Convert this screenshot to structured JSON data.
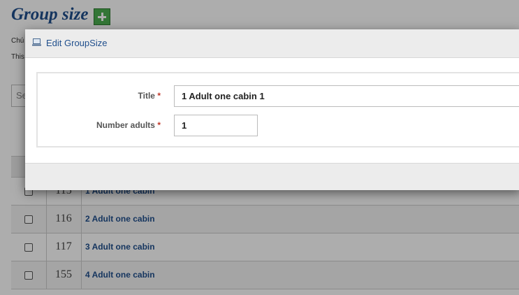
{
  "page": {
    "title": "Group size",
    "intro_line_1": "Chú",
    "intro_line_2": "This",
    "search_placeholder": "Se"
  },
  "table": {
    "rows": [
      {
        "id": "115",
        "title": "1 Adult one cabin"
      },
      {
        "id": "116",
        "title": "2 Adult one cabin"
      },
      {
        "id": "117",
        "title": "3 Adult one cabin"
      },
      {
        "id": "155",
        "title": "4 Adult one cabin"
      }
    ]
  },
  "modal": {
    "title": "Edit GroupSize",
    "fields": {
      "title_label": "Title",
      "title_value": "1 Adult one cabin 1",
      "adults_label": "Number adults",
      "adults_value": "1",
      "required_mark": "*"
    }
  },
  "colors": {
    "link": "#1f4e8c",
    "add_button": "#4caf50",
    "required": "#c0392b"
  },
  "icons": {
    "add": "plus-icon",
    "modal": "computer-icon"
  }
}
